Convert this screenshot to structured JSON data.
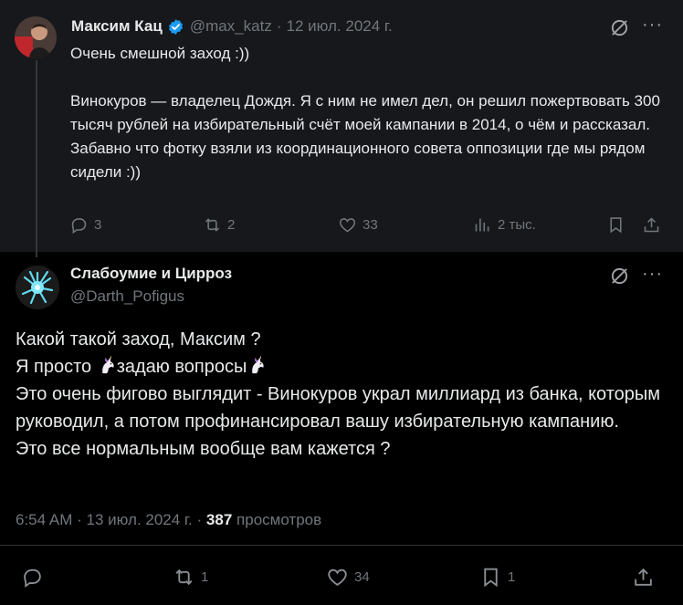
{
  "parent_tweet": {
    "author_name": "Максим Кац",
    "handle": "@max_katz",
    "date": "12 июл. 2024 г.",
    "text": "Очень смешной заход :))\n\nВинокуров — владелец Дождя. Я с ним не имел дел, он решил пожертвовать 300 тысяч рублей на избирательный счёт моей кампании в 2014, о чём и рассказал.\nЗабавно что фотку взяли из координационного совета оппозиции где мы рядом сидели :))",
    "reply_count": "3",
    "retweet_count": "2",
    "like_count": "33",
    "view_count": "2 тыс."
  },
  "reply_tweet": {
    "author_name": "Слабоумие и Цирроз",
    "handle": "@Darth_Pofigus",
    "line1": "Какой такой заход, Максим ?",
    "line2_a": "Я просто ",
    "line2_b": "задаю вопросы",
    "line3": "Это очень фигово выглядит - Винокуров украл миллиард из банка, которым руководил, а потом профинансировал вашу избирательную кампанию.",
    "line4": "Это все нормальным вообще вам кажется ?",
    "time": "6:54 AM",
    "date": "13 июл. 2024 г.",
    "views": "387",
    "views_label": "просмотров",
    "reply_count": "",
    "retweet_count": "1",
    "like_count": "34",
    "bookmark_count": "1"
  },
  "colors": {
    "background": "#000000",
    "parent_background": "#16181c",
    "text": "#e7e9ea",
    "muted": "#71767b",
    "verified": "#1d9bf0",
    "divider": "#2f3336"
  },
  "icons": [
    "verified-badge-icon",
    "grok-icon",
    "more-icon",
    "reply-icon",
    "retweet-icon",
    "like-icon",
    "views-icon",
    "bookmark-icon",
    "share-icon",
    "unicorn-emoji"
  ]
}
